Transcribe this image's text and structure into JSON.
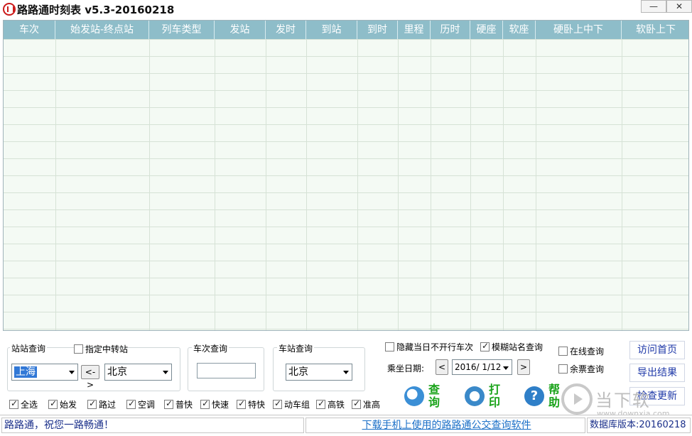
{
  "window": {
    "title": "路路通时刻表 v5.3-20160218",
    "minimize_label": "—",
    "close_label": "✕"
  },
  "grid": {
    "columns": [
      "车次",
      "始发站-终点站",
      "列车类型",
      "发站",
      "发时",
      "到站",
      "到时",
      "里程",
      "历时",
      "硬座",
      "软座",
      "硬卧上中下",
      "软卧上下"
    ],
    "rows": []
  },
  "station_query": {
    "title": "站站查询",
    "transfer_label": "指定中转站",
    "transfer_checked": false,
    "from_station": "上海",
    "swap_label": "<->",
    "to_station": "北京"
  },
  "train_query": {
    "title": "车次查询",
    "value": ""
  },
  "stop_query": {
    "title": "车站查询",
    "station": "北京"
  },
  "options": {
    "hide_not_running": "隐藏当日不开行车次",
    "fuzzy_name": "模糊站名查询",
    "date_label": "乘坐日期:",
    "date_value": "2016/  1/12",
    "prev": "<",
    "next": ">"
  },
  "actions": {
    "query": "查询",
    "print": "打印",
    "help": "帮助"
  },
  "extras": {
    "online_query": "在线查询",
    "ticket_query": "余票查询",
    "visit_home": "访问首页",
    "export": "导出结果",
    "check_update": "检查更新"
  },
  "train_types": [
    {
      "label": "全选",
      "checked": true
    },
    {
      "label": "始发",
      "checked": true
    },
    {
      "label": "路过",
      "checked": true
    },
    {
      "label": "空调",
      "checked": true
    },
    {
      "label": "普快",
      "checked": true
    },
    {
      "label": "快速",
      "checked": true
    },
    {
      "label": "特快",
      "checked": true
    },
    {
      "label": "动车组",
      "checked": true
    },
    {
      "label": "高铁",
      "checked": true
    },
    {
      "label": "准高",
      "checked": true
    }
  ],
  "status": {
    "greeting": "路路通，祝您一路畅通！",
    "link": "下载手机上使用的路路通公交查询软件",
    "db_version": "数据库版本:20160218"
  },
  "watermark": {
    "text": "当下软件园",
    "url": "www.downxia.com"
  },
  "colors": {
    "header": "#8ebdc9",
    "grid_bg": "#f4faf4",
    "accent_green": "#1aa31a",
    "link_blue": "#1f39a8"
  }
}
